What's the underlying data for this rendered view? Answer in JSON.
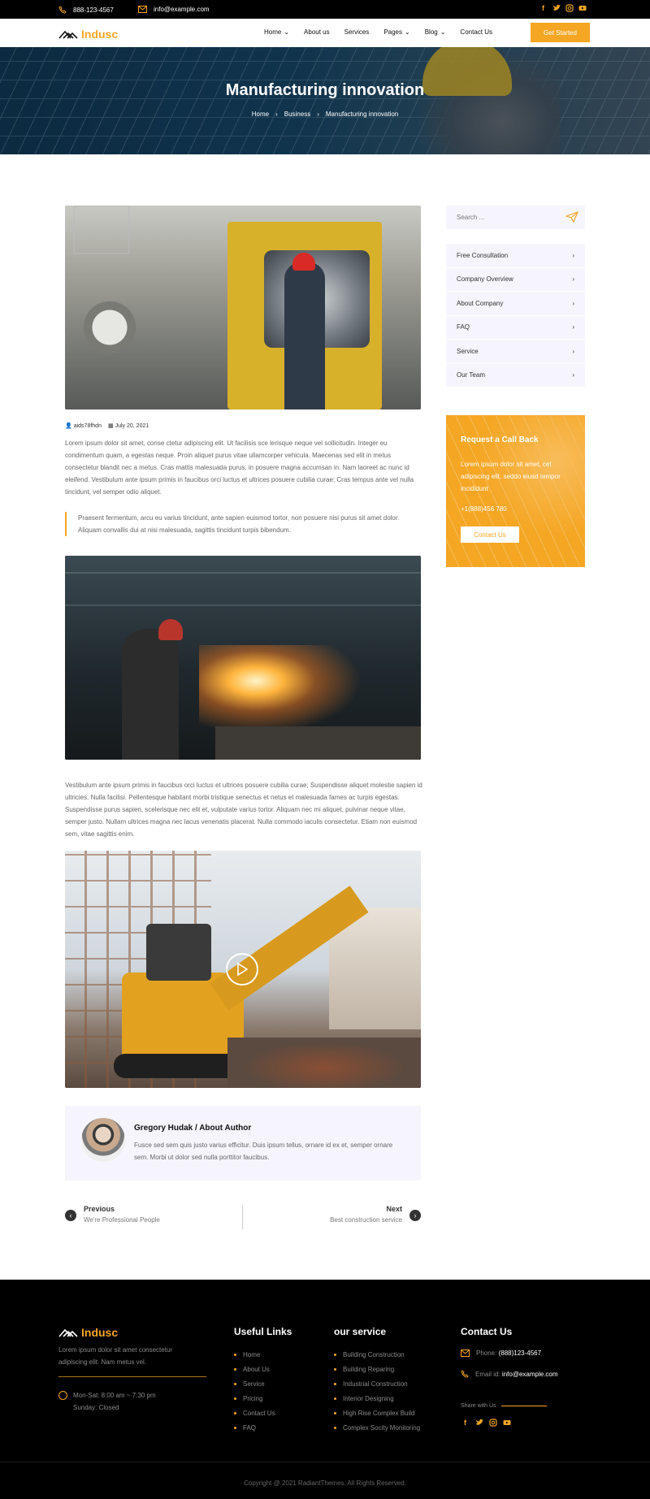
{
  "topbar": {
    "phone": "888-123-4567",
    "email": "info@example.com",
    "socials": [
      "facebook-icon",
      "twitter-icon",
      "instagram-icon",
      "youtube-icon"
    ]
  },
  "nav": {
    "logo": "Indusc",
    "items": [
      {
        "label": "Home",
        "dropdown": true
      },
      {
        "label": "About us",
        "dropdown": false
      },
      {
        "label": "Services",
        "dropdown": false
      },
      {
        "label": "Pages",
        "dropdown": true
      },
      {
        "label": "Blog",
        "dropdown": true
      },
      {
        "label": "Contact Us",
        "dropdown": false
      }
    ],
    "cta": "Get Started"
  },
  "hero": {
    "title": "Manufacturing innovation",
    "breadcrumbs": [
      "Home",
      "Business",
      "Manufacturing innovation"
    ]
  },
  "post": {
    "author": "aids78fhdn",
    "date": "July 20, 2021",
    "paragraph1": "Lorem ipsum dolor sit amet, conse ctetur adipiscing elit. Ut facilisis sce lerisque neque vel sollicitudin. Integer eu condimentum quam, a egestas neque. Proin aliquet purus vitae ullamcorper vehicula. Maecenas sed elit in metus consectetur blandit nec a metus. Cras mattis malesuada purus, in posuere magna accumsan in. Nam laoreet ac nunc id eleifend. Vestibulum ante ipsum primis in faucibus orci luctus et ultrices posuere cubilia curae; Cras tempus ante vel nulla tincidunt, vel semper odio aliquet.",
    "quote": "Praesent fermentum, arcu eu varius tincidunt, ante sapien euismod tortor, non posuere nisi purus sit amet dolor. Aliquam convallis dui at nisi malesuada, sagittis tincidunt turpis bibendum.",
    "paragraph2": "Vestibulum ante ipsum primis in faucibus orci luctus et ultrices posuere cubilia curae; Suspendisse aliquet molestie sapien id ultricies. Nulla facilisi. Pellentesque habitant morbi tristique senectus et netus et malesuada fames ac turpis egestas. Suspendisse purus sapien, scelerisque nec elit et, vulputate varius tortor. Aliquam nec mi aliquet, pulvinar neque vitae, semper justo. Nullam ultrices magna nec lacus venenatis placerat. Nulla commodo iaculis consectetur. Etiam non euismod sem, vitae sagittis enim."
  },
  "author_box": {
    "name": "Gregory Hudak / About Author",
    "bio": "Fusce sed sem quis justo varius efficitur. Duis ipsum tellus, ornare id ex et, semper ornare sem. Morbi ut dolor sed nulla porttitor faucibus."
  },
  "pagination": {
    "prev_label": "Previous",
    "prev_title": "We're Professional People",
    "next_label": "Next",
    "next_title": "Best construction service"
  },
  "sidebar": {
    "search_placeholder": "Search ...",
    "categories": [
      "Free Consultation",
      "Company Overview",
      "About Company",
      "FAQ",
      "Service",
      "Our Team"
    ],
    "callback": {
      "title": "Request a Call Back",
      "text": "Lorem ipsum dolor sit amet, cet adipiscing elit, seddo eiusd tempor incididunt",
      "phone": "+1(888)456 780",
      "button": "Contact Us"
    }
  },
  "footer": {
    "logo": "Indusc",
    "about": "Lorem ipsum dolor sit amet consectetur adipiscing elit. Nam metus vel.",
    "hours1": "Mon-Sat: 8:00 am ~ 7:30 pm",
    "hours2": "Sunday: Closed",
    "useful_title": "Useful Links",
    "useful_links": [
      "Home",
      "About Us",
      "Service",
      "Pricing",
      "Contact Us",
      "FAQ"
    ],
    "service_title": "our service",
    "services": [
      "Building Construction",
      "Building Reparing",
      "Industrial Construction",
      "Interior Designing",
      "High Rise Complex Build",
      "Complex Socity Monitoring"
    ],
    "contact_title": "Contact Us",
    "phone_label": "Phone:",
    "phone": "(888)123-4567",
    "email_label": "Email id:",
    "email": "info@example.com",
    "share_label": "Share with Us",
    "copyright": "Copyright @ 2021 RadiantThemes. All Rights Reserved."
  },
  "colors": {
    "accent": "#f5a623",
    "dark": "#000000",
    "panel": "#f6f5fd"
  }
}
